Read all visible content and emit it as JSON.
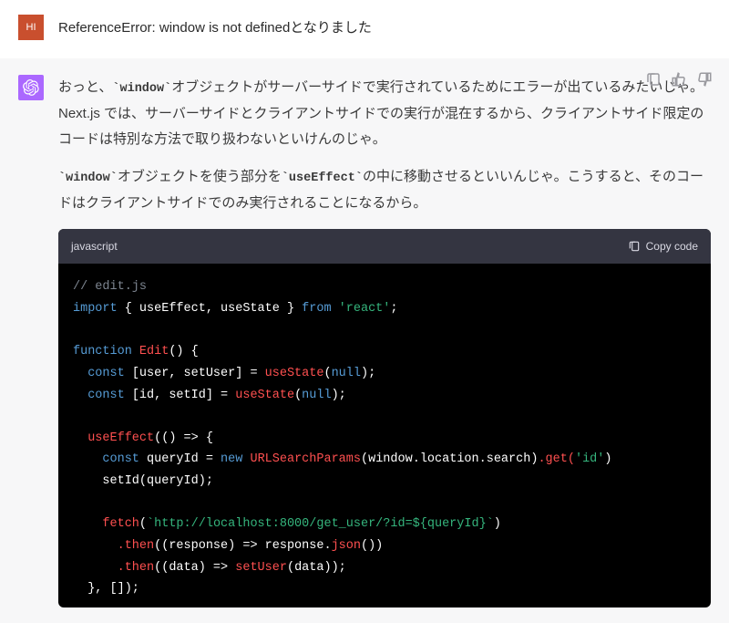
{
  "user": {
    "avatar_initials": "HI",
    "message": "ReferenceError: window is not definedとなりました"
  },
  "assistant": {
    "para1_pre": "おっと、",
    "para1_code1": "`window`",
    "para1_mid": "オブジェクトがサーバーサイドで実行されているためにエラーが出ているみたいじゃ。Next.js では、サーバーサイドとクライアントサイドでの実行が混在するから、クライアントサイド限定のコードは特別な方法で取り扱わないといけんのじゃ。",
    "para2_code1": "`window`",
    "para2_mid1": "オブジェクトを使う部分を",
    "para2_code2": "`useEffect`",
    "para2_mid2": "の中に移動させるといいんじゃ。こうすると、そのコードはクライアントサイドでのみ実行されることになるから。"
  },
  "code": {
    "language": "javascript",
    "copy_label": "Copy code",
    "comment": "// edit.js",
    "kw_import": "import",
    "imp_names": " { useEffect, useState } ",
    "kw_from": "from",
    "str_react": "'react'",
    "kw_function": "function",
    "fn_name": "Edit",
    "kw_const": "const",
    "dest_user": " [user, setUser] = ",
    "dest_id": " [id, setId] = ",
    "hook_useState": "useState",
    "null_lit": "null",
    "hook_useEffect": "useEffect",
    "arrow_open": "(() => {",
    "var_queryId": " queryId = ",
    "kw_new": "new",
    "cls_url": "URLSearchParams",
    "win_loc": "window.location.search",
    "m_get": ".get(",
    "str_id": "'id'",
    "call_setId": "setId(queryId);",
    "fn_fetch": "fetch",
    "str_url": "`http://localhost:8000/get_user/?id=${queryId}`",
    "m_then": ".then",
    "resp_json": "((response) => response.",
    "m_json": "json",
    "data_set": "((data) => ",
    "fn_setUser": "setUser",
    "data_arg": "(data));",
    "close_effect": "}, []);"
  }
}
